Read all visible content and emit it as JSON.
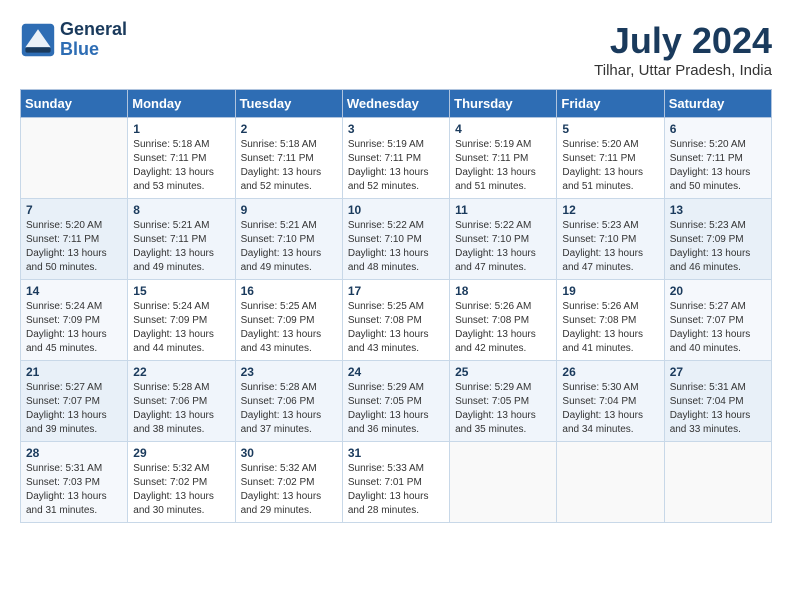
{
  "header": {
    "logo_line1": "General",
    "logo_line2": "Blue",
    "month_year": "July 2024",
    "location": "Tilhar, Uttar Pradesh, India"
  },
  "days_of_week": [
    "Sunday",
    "Monday",
    "Tuesday",
    "Wednesday",
    "Thursday",
    "Friday",
    "Saturday"
  ],
  "weeks": [
    [
      {
        "day": "",
        "info": ""
      },
      {
        "day": "1",
        "info": "Sunrise: 5:18 AM\nSunset: 7:11 PM\nDaylight: 13 hours\nand 53 minutes."
      },
      {
        "day": "2",
        "info": "Sunrise: 5:18 AM\nSunset: 7:11 PM\nDaylight: 13 hours\nand 52 minutes."
      },
      {
        "day": "3",
        "info": "Sunrise: 5:19 AM\nSunset: 7:11 PM\nDaylight: 13 hours\nand 52 minutes."
      },
      {
        "day": "4",
        "info": "Sunrise: 5:19 AM\nSunset: 7:11 PM\nDaylight: 13 hours\nand 51 minutes."
      },
      {
        "day": "5",
        "info": "Sunrise: 5:20 AM\nSunset: 7:11 PM\nDaylight: 13 hours\nand 51 minutes."
      },
      {
        "day": "6",
        "info": "Sunrise: 5:20 AM\nSunset: 7:11 PM\nDaylight: 13 hours\nand 50 minutes."
      }
    ],
    [
      {
        "day": "7",
        "info": "Sunrise: 5:20 AM\nSunset: 7:11 PM\nDaylight: 13 hours\nand 50 minutes."
      },
      {
        "day": "8",
        "info": "Sunrise: 5:21 AM\nSunset: 7:11 PM\nDaylight: 13 hours\nand 49 minutes."
      },
      {
        "day": "9",
        "info": "Sunrise: 5:21 AM\nSunset: 7:10 PM\nDaylight: 13 hours\nand 49 minutes."
      },
      {
        "day": "10",
        "info": "Sunrise: 5:22 AM\nSunset: 7:10 PM\nDaylight: 13 hours\nand 48 minutes."
      },
      {
        "day": "11",
        "info": "Sunrise: 5:22 AM\nSunset: 7:10 PM\nDaylight: 13 hours\nand 47 minutes."
      },
      {
        "day": "12",
        "info": "Sunrise: 5:23 AM\nSunset: 7:10 PM\nDaylight: 13 hours\nand 47 minutes."
      },
      {
        "day": "13",
        "info": "Sunrise: 5:23 AM\nSunset: 7:09 PM\nDaylight: 13 hours\nand 46 minutes."
      }
    ],
    [
      {
        "day": "14",
        "info": "Sunrise: 5:24 AM\nSunset: 7:09 PM\nDaylight: 13 hours\nand 45 minutes."
      },
      {
        "day": "15",
        "info": "Sunrise: 5:24 AM\nSunset: 7:09 PM\nDaylight: 13 hours\nand 44 minutes."
      },
      {
        "day": "16",
        "info": "Sunrise: 5:25 AM\nSunset: 7:09 PM\nDaylight: 13 hours\nand 43 minutes."
      },
      {
        "day": "17",
        "info": "Sunrise: 5:25 AM\nSunset: 7:08 PM\nDaylight: 13 hours\nand 43 minutes."
      },
      {
        "day": "18",
        "info": "Sunrise: 5:26 AM\nSunset: 7:08 PM\nDaylight: 13 hours\nand 42 minutes."
      },
      {
        "day": "19",
        "info": "Sunrise: 5:26 AM\nSunset: 7:08 PM\nDaylight: 13 hours\nand 41 minutes."
      },
      {
        "day": "20",
        "info": "Sunrise: 5:27 AM\nSunset: 7:07 PM\nDaylight: 13 hours\nand 40 minutes."
      }
    ],
    [
      {
        "day": "21",
        "info": "Sunrise: 5:27 AM\nSunset: 7:07 PM\nDaylight: 13 hours\nand 39 minutes."
      },
      {
        "day": "22",
        "info": "Sunrise: 5:28 AM\nSunset: 7:06 PM\nDaylight: 13 hours\nand 38 minutes."
      },
      {
        "day": "23",
        "info": "Sunrise: 5:28 AM\nSunset: 7:06 PM\nDaylight: 13 hours\nand 37 minutes."
      },
      {
        "day": "24",
        "info": "Sunrise: 5:29 AM\nSunset: 7:05 PM\nDaylight: 13 hours\nand 36 minutes."
      },
      {
        "day": "25",
        "info": "Sunrise: 5:29 AM\nSunset: 7:05 PM\nDaylight: 13 hours\nand 35 minutes."
      },
      {
        "day": "26",
        "info": "Sunrise: 5:30 AM\nSunset: 7:04 PM\nDaylight: 13 hours\nand 34 minutes."
      },
      {
        "day": "27",
        "info": "Sunrise: 5:31 AM\nSunset: 7:04 PM\nDaylight: 13 hours\nand 33 minutes."
      }
    ],
    [
      {
        "day": "28",
        "info": "Sunrise: 5:31 AM\nSunset: 7:03 PM\nDaylight: 13 hours\nand 31 minutes."
      },
      {
        "day": "29",
        "info": "Sunrise: 5:32 AM\nSunset: 7:02 PM\nDaylight: 13 hours\nand 30 minutes."
      },
      {
        "day": "30",
        "info": "Sunrise: 5:32 AM\nSunset: 7:02 PM\nDaylight: 13 hours\nand 29 minutes."
      },
      {
        "day": "31",
        "info": "Sunrise: 5:33 AM\nSunset: 7:01 PM\nDaylight: 13 hours\nand 28 minutes."
      },
      {
        "day": "",
        "info": ""
      },
      {
        "day": "",
        "info": ""
      },
      {
        "day": "",
        "info": ""
      }
    ]
  ]
}
